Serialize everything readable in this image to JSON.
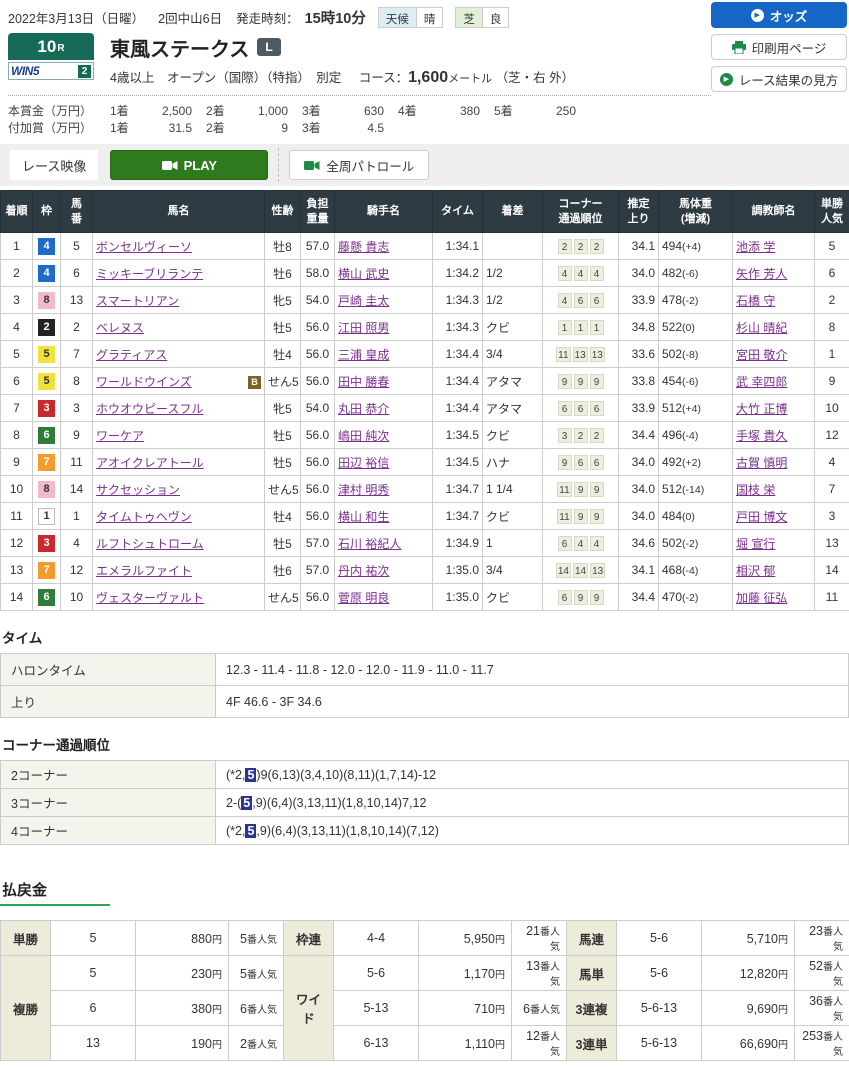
{
  "header": {
    "date": "2022年3月13日（日曜）",
    "meeting": "2回中山6日",
    "start_label": "発走時刻：",
    "start_time": "15時10分",
    "weather_label": "天候",
    "weather_value": "晴",
    "turf_label": "芝",
    "turf_value": "良",
    "race_number": "10",
    "race_number_suffix": "R",
    "win5_label": "WIN5",
    "win5_num": "2",
    "race_name": "東風ステークス",
    "grade": "L",
    "conditions": "4歳以上　オープン（国際）（特指）　別定",
    "course_label": "コース：",
    "course_value": "1,600",
    "course_unit_small": "メートル",
    "course_unit_tail": "（芝・右 外）",
    "prize_rows": [
      {
        "label": "本賞金（万円）",
        "items": [
          {
            "k": "1着",
            "v": "2,500"
          },
          {
            "k": "2着",
            "v": "1,000"
          },
          {
            "k": "3着",
            "v": "630"
          },
          {
            "k": "4着",
            "v": "380"
          },
          {
            "k": "5着",
            "v": "250"
          }
        ]
      },
      {
        "label": "付加賞（万円）",
        "items": [
          {
            "k": "1着",
            "v": "31.5"
          },
          {
            "k": "2着",
            "v": "9"
          },
          {
            "k": "3着",
            "v": "4.5"
          }
        ]
      }
    ],
    "buttons": {
      "odds": "オッズ",
      "print": "印刷用ページ",
      "guide": "レース結果の見方"
    }
  },
  "video_bar": {
    "label": "レース映像",
    "play": "PLAY",
    "patrol": "全周パトロール"
  },
  "results": {
    "columns": [
      "着順",
      "枠",
      "馬\n番",
      "馬名",
      "性齢",
      "負担\n重量",
      "騎手名",
      "タイム",
      "着差",
      "コーナー\n通過順位",
      "推定\n上り",
      "馬体重\n(増減)",
      "調教師名",
      "単勝\n人気"
    ],
    "rows": [
      {
        "pos": "1",
        "waku": "4",
        "num": "5",
        "name": "ボンセルヴィーソ",
        "blinker": false,
        "sex_age": "牡8",
        "weight": "57.0",
        "jockey": "藤懸 貴志",
        "time": "1:34.1",
        "margin": "",
        "corners": [
          "2",
          "2",
          "2"
        ],
        "last3f": "34.1",
        "bw": "494",
        "bw_diff": "(+4)",
        "trainer": "池添 学",
        "pop": "5"
      },
      {
        "pos": "2",
        "waku": "4",
        "num": "6",
        "name": "ミッキーブリランテ",
        "blinker": false,
        "sex_age": "牡6",
        "weight": "58.0",
        "jockey": "横山 武史",
        "time": "1:34.2",
        "margin": "1/2",
        "corners": [
          "4",
          "4",
          "4"
        ],
        "last3f": "34.0",
        "bw": "482",
        "bw_diff": "(-6)",
        "trainer": "矢作 芳人",
        "pop": "6"
      },
      {
        "pos": "3",
        "waku": "8",
        "num": "13",
        "name": "スマートリアン",
        "blinker": false,
        "sex_age": "牝5",
        "weight": "54.0",
        "jockey": "戸崎 圭太",
        "time": "1:34.3",
        "margin": "1/2",
        "corners": [
          "4",
          "6",
          "6"
        ],
        "last3f": "33.9",
        "bw": "478",
        "bw_diff": "(-2)",
        "trainer": "石橋 守",
        "pop": "2"
      },
      {
        "pos": "4",
        "waku": "2",
        "num": "2",
        "name": "ベレヌス",
        "blinker": false,
        "sex_age": "牡5",
        "weight": "56.0",
        "jockey": "江田 照男",
        "time": "1:34.3",
        "margin": "クビ",
        "corners": [
          "1",
          "1",
          "1"
        ],
        "last3f": "34.8",
        "bw": "522",
        "bw_diff": "(0)",
        "trainer": "杉山 晴紀",
        "pop": "8"
      },
      {
        "pos": "5",
        "waku": "5",
        "num": "7",
        "name": "グラティアス",
        "blinker": false,
        "sex_age": "牡4",
        "weight": "56.0",
        "jockey": "三浦 皇成",
        "time": "1:34.4",
        "margin": "3/4",
        "corners": [
          "11",
          "13",
          "13"
        ],
        "last3f": "33.6",
        "bw": "502",
        "bw_diff": "(-8)",
        "trainer": "宮田 敬介",
        "pop": "1"
      },
      {
        "pos": "6",
        "waku": "5",
        "num": "8",
        "name": "ワールドウインズ",
        "blinker": true,
        "sex_age": "せん5",
        "weight": "56.0",
        "jockey": "田中 勝春",
        "time": "1:34.4",
        "margin": "アタマ",
        "corners": [
          "9",
          "9",
          "9"
        ],
        "last3f": "33.8",
        "bw": "454",
        "bw_diff": "(-6)",
        "trainer": "武 幸四郎",
        "pop": "9"
      },
      {
        "pos": "7",
        "waku": "3",
        "num": "3",
        "name": "ホウオウピースフル",
        "blinker": false,
        "sex_age": "牝5",
        "weight": "54.0",
        "jockey": "丸田 恭介",
        "time": "1:34.4",
        "margin": "アタマ",
        "corners": [
          "6",
          "6",
          "6"
        ],
        "last3f": "33.9",
        "bw": "512",
        "bw_diff": "(+4)",
        "trainer": "大竹 正博",
        "pop": "10"
      },
      {
        "pos": "8",
        "waku": "6",
        "num": "9",
        "name": "ワーケア",
        "blinker": false,
        "sex_age": "牡5",
        "weight": "56.0",
        "jockey": "嶋田 純次",
        "time": "1:34.5",
        "margin": "クビ",
        "corners": [
          "3",
          "2",
          "2"
        ],
        "last3f": "34.4",
        "bw": "496",
        "bw_diff": "(-4)",
        "trainer": "手塚 貴久",
        "pop": "12"
      },
      {
        "pos": "9",
        "waku": "7",
        "num": "11",
        "name": "アオイクレアトール",
        "blinker": false,
        "sex_age": "牡5",
        "weight": "56.0",
        "jockey": "田辺 裕信",
        "time": "1:34.5",
        "margin": "ハナ",
        "corners": [
          "9",
          "6",
          "6"
        ],
        "last3f": "34.0",
        "bw": "492",
        "bw_diff": "(+2)",
        "trainer": "古賀 慎明",
        "pop": "4"
      },
      {
        "pos": "10",
        "waku": "8",
        "num": "14",
        "name": "サクセッション",
        "blinker": false,
        "sex_age": "せん5",
        "weight": "56.0",
        "jockey": "津村 明秀",
        "time": "1:34.7",
        "margin": "1 1/4",
        "corners": [
          "11",
          "9",
          "9"
        ],
        "last3f": "34.0",
        "bw": "512",
        "bw_diff": "(-14)",
        "trainer": "国枝 栄",
        "pop": "7"
      },
      {
        "pos": "11",
        "waku": "1",
        "num": "1",
        "name": "タイムトゥヘヴン",
        "blinker": false,
        "sex_age": "牡4",
        "weight": "56.0",
        "jockey": "横山 和生",
        "time": "1:34.7",
        "margin": "クビ",
        "corners": [
          "11",
          "9",
          "9"
        ],
        "last3f": "34.0",
        "bw": "484",
        "bw_diff": "(0)",
        "trainer": "戸田 博文",
        "pop": "3"
      },
      {
        "pos": "12",
        "waku": "3",
        "num": "4",
        "name": "ルフトシュトローム",
        "blinker": false,
        "sex_age": "牡5",
        "weight": "57.0",
        "jockey": "石川 裕紀人",
        "time": "1:34.9",
        "margin": "1",
        "corners": [
          "6",
          "4",
          "4"
        ],
        "last3f": "34.6",
        "bw": "502",
        "bw_diff": "(-2)",
        "trainer": "堀 宣行",
        "pop": "13"
      },
      {
        "pos": "13",
        "waku": "7",
        "num": "12",
        "name": "エメラルファイト",
        "blinker": false,
        "sex_age": "牡6",
        "weight": "57.0",
        "jockey": "丹内 祐次",
        "time": "1:35.0",
        "margin": "3/4",
        "corners": [
          "14",
          "14",
          "13"
        ],
        "last3f": "34.1",
        "bw": "468",
        "bw_diff": "(-4)",
        "trainer": "相沢 郁",
        "pop": "14"
      },
      {
        "pos": "14",
        "waku": "6",
        "num": "10",
        "name": "ヴェスターヴァルト",
        "blinker": false,
        "sex_age": "せん5",
        "weight": "56.0",
        "jockey": "菅原 明良",
        "time": "1:35.0",
        "margin": "クビ",
        "corners": [
          "6",
          "9",
          "9"
        ],
        "last3f": "34.4",
        "bw": "470",
        "bw_diff": "(-2)",
        "trainer": "加藤 征弘",
        "pop": "11"
      }
    ]
  },
  "time_section": {
    "title": "タイム",
    "rows": [
      {
        "label": "ハロンタイム",
        "value": "12.3 - 11.4 - 11.8 - 12.0 - 12.0 - 11.9 - 11.0 - 11.7"
      },
      {
        "label": "上り",
        "value": "4F 46.6 - 3F 34.6"
      }
    ]
  },
  "corner_section": {
    "title": "コーナー通過順位",
    "rows": [
      {
        "label": "2コーナー",
        "pre": "(*2,",
        "hl": "5",
        "post": ")9(6,13)(3,4,10)(8,11)(1,7,14)-12"
      },
      {
        "label": "3コーナー",
        "pre": "2-(",
        "hl": "5",
        "post": ",9)(6,4)(3,13,11)(1,8,10,14)7,12"
      },
      {
        "label": "4コーナー",
        "pre": "(*2,",
        "hl": "5",
        "post": ",9)(6,4)(3,13,11)(1,8,10,14)(7,12)"
      }
    ]
  },
  "payout": {
    "title": "払戻金",
    "pay_suffix": "円",
    "pop_suffix": "番人気",
    "rows": [
      [
        {
          "type": "単勝",
          "combo": "5",
          "pay": "880",
          "pop": "5"
        },
        {
          "type": "枠連",
          "combo": "4-4",
          "pay": "5,950",
          "pop": "21"
        },
        {
          "type": "馬連",
          "combo": "5-6",
          "pay": "5,710",
          "pop": "23"
        }
      ],
      [
        {
          "type": "複勝",
          "typespan": 3,
          "combo": "5",
          "pay": "230",
          "pop": "5"
        },
        {
          "type": "ワイド",
          "typespan": 3,
          "combo": "5-6",
          "pay": "1,170",
          "pop": "13"
        },
        {
          "type": "馬単",
          "combo": "5-6",
          "pay": "12,820",
          "pop": "52"
        }
      ],
      [
        {
          "combo": "6",
          "pay": "380",
          "pop": "6",
          "cont": true
        },
        {
          "combo": "5-13",
          "pay": "710",
          "pop": "6",
          "cont": true
        },
        {
          "type": "3連複",
          "combo": "5-6-13",
          "pay": "9,690",
          "pop": "36"
        }
      ],
      [
        {
          "combo": "13",
          "pay": "190",
          "pop": "2",
          "cont": true
        },
        {
          "combo": "6-13",
          "pay": "1,110",
          "pop": "12",
          "cont": true
        },
        {
          "type": "3連単",
          "combo": "5-6-13",
          "pay": "66,690",
          "pop": "253"
        }
      ]
    ]
  }
}
